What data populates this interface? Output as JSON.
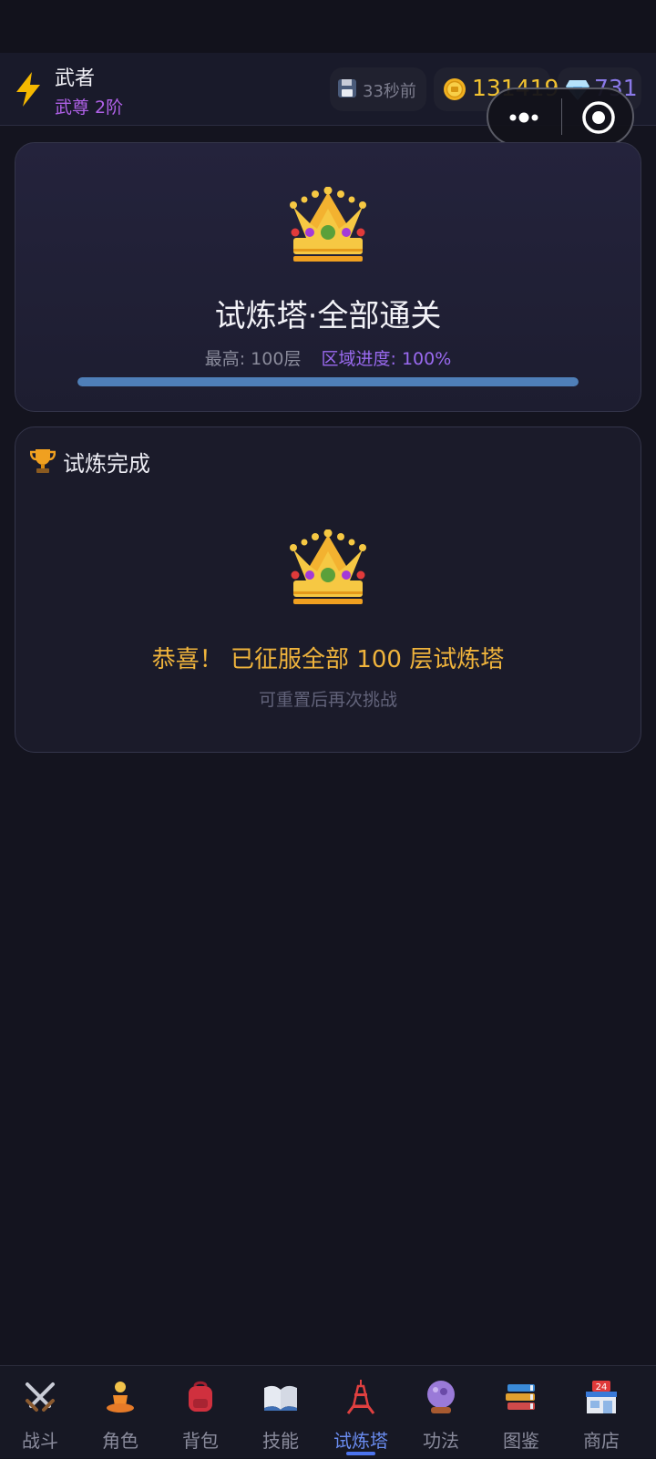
{
  "header": {
    "player_name": "武者",
    "player_rank": "武尊 2阶",
    "save_status": "33秒前",
    "gold": "131419",
    "gems": "731"
  },
  "tower_card": {
    "title": "试炼塔·全部通关",
    "best_floor": "最高: 100层",
    "area_progress": "区域进度: 100%",
    "progress_fraction": 1.0
  },
  "complete_card": {
    "heading": "试炼完成",
    "congrats": "恭喜！ 已征服全部 100 层试炼塔",
    "hint": "可重置后再次挑战"
  },
  "nav": {
    "items": [
      {
        "label": "战斗",
        "icon": "crossed-swords-icon"
      },
      {
        "label": "角色",
        "icon": "meditating-person-icon"
      },
      {
        "label": "背包",
        "icon": "backpack-icon"
      },
      {
        "label": "技能",
        "icon": "open-book-icon"
      },
      {
        "label": "试炼塔",
        "icon": "tower-icon",
        "active": true
      },
      {
        "label": "功法",
        "icon": "crystal-ball-icon"
      },
      {
        "label": "图鉴",
        "icon": "books-icon"
      },
      {
        "label": "商店",
        "icon": "convenience-store-icon"
      }
    ]
  },
  "colors": {
    "background": "#14141f",
    "accent_purple": "#9a6af0",
    "gold": "#f2c230",
    "nav_active": "#4c74ee"
  }
}
